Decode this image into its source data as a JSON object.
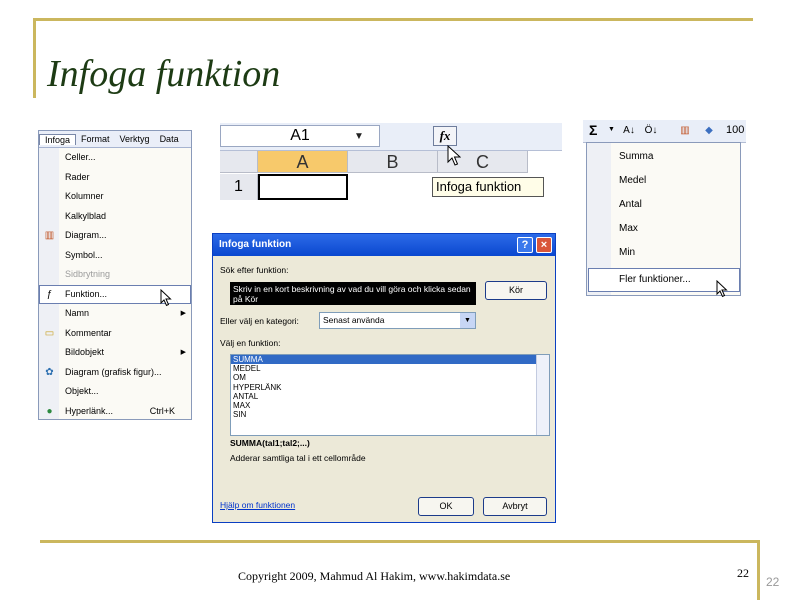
{
  "slide": {
    "title": "Infoga funktion",
    "footer": "Copyright 2009, Mahmud Al Hakim, www.hakimdata.se",
    "page_number": "22",
    "page_number_secondary": "22"
  },
  "menu_shot": {
    "menubar": [
      "Infoga",
      "Format",
      "Verktyg",
      "Data"
    ],
    "items": [
      {
        "label": "Celler...",
        "icon": "",
        "submenu": false,
        "disabled": false
      },
      {
        "label": "Rader",
        "icon": "",
        "submenu": false,
        "disabled": false
      },
      {
        "label": "Kolumner",
        "icon": "",
        "submenu": false,
        "disabled": false
      },
      {
        "label": "Kalkylblad",
        "icon": "",
        "submenu": false,
        "disabled": false
      },
      {
        "label": "Diagram...",
        "icon": "chart-icon",
        "submenu": false,
        "disabled": false
      },
      {
        "label": "Symbol...",
        "icon": "",
        "submenu": false,
        "disabled": false
      },
      {
        "label": "Sidbrytning",
        "icon": "",
        "submenu": false,
        "disabled": true
      },
      {
        "label": "Funktion...",
        "icon": "function-icon",
        "submenu": false,
        "disabled": false,
        "selected": true
      },
      {
        "label": "Namn",
        "icon": "",
        "submenu": true,
        "disabled": false
      },
      {
        "label": "Kommentar",
        "icon": "comment-icon",
        "submenu": false,
        "disabled": false
      },
      {
        "label": "Bildobjekt",
        "icon": "",
        "submenu": true,
        "disabled": false
      },
      {
        "label": "Diagram (grafisk figur)...",
        "icon": "diagram-icon",
        "submenu": false,
        "disabled": false
      },
      {
        "label": "Objekt...",
        "icon": "",
        "submenu": false,
        "disabled": false
      },
      {
        "label": "Hyperlänk...",
        "icon": "globe-icon",
        "submenu": false,
        "disabled": false,
        "shortcut": "Ctrl+K"
      }
    ]
  },
  "grid_shot": {
    "name_box": "A1",
    "fx_label": "fx",
    "columns": [
      "A",
      "B",
      "C"
    ],
    "row": "1",
    "tooltip": "Infoga funktion"
  },
  "dialog": {
    "title": "Infoga funktion",
    "help_btn": "?",
    "close_btn": "×",
    "search_label": "Sök efter funktion:",
    "search_text": "Skriv in en kort beskrivning av vad du vill göra och klicka sedan på Kör",
    "go_button": "Kör",
    "category_label": "Eller välj en kategori:",
    "category_value": "Senast använda",
    "function_list_label": "Välj en funktion:",
    "functions": [
      "SUMMA",
      "MEDEL",
      "OM",
      "HYPERLÄNK",
      "ANTAL",
      "MAX",
      "SIN"
    ],
    "syntax": "SUMMA(tal1;tal2;...)",
    "description": "Adderar samtliga tal i ett cellområde",
    "help_link": "Hjälp om funktionen",
    "ok_button": "OK",
    "cancel_button": "Avbryt"
  },
  "sum_shot": {
    "sigma": "Σ",
    "zoom": "100",
    "items": [
      "Summa",
      "Medel",
      "Antal",
      "Max",
      "Min"
    ],
    "more": "Fler funktioner..."
  }
}
